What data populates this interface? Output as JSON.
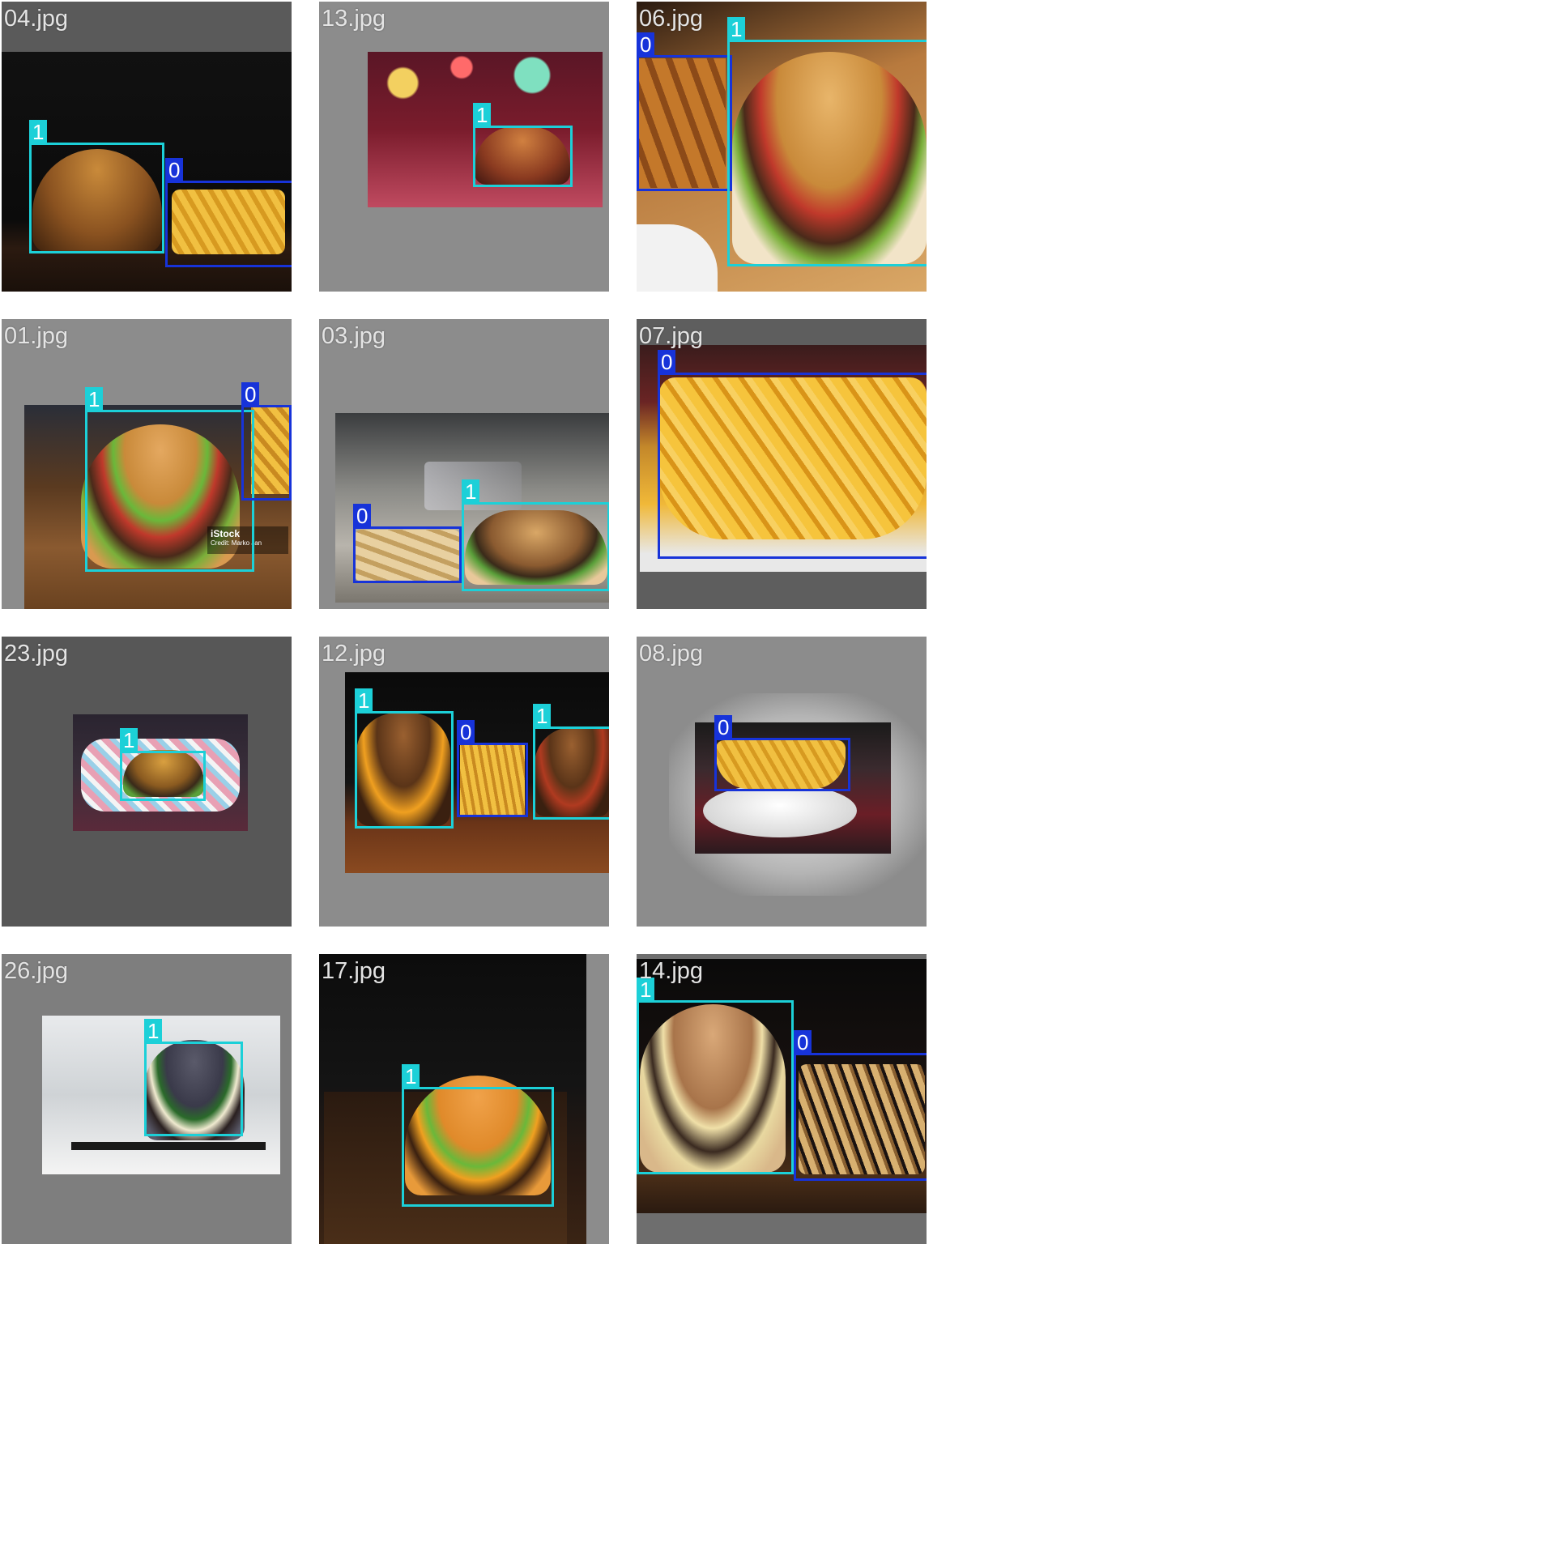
{
  "colors": {
    "class_0": "#1733d9",
    "class_1": "#1cd0d8",
    "label_text": "#e4e4e4",
    "page_bg": "#ffffff"
  },
  "tiles": [
    {
      "filename": "04.jpg",
      "boxes": [
        {
          "class_label": "1"
        },
        {
          "class_label": "0"
        }
      ]
    },
    {
      "filename": "13.jpg",
      "boxes": [
        {
          "class_label": "1"
        }
      ]
    },
    {
      "filename": "06.jpg",
      "boxes": [
        {
          "class_label": "0"
        },
        {
          "class_label": "1"
        }
      ]
    },
    {
      "filename": "01.jpg",
      "boxes": [
        {
          "class_label": "1"
        },
        {
          "class_label": "0"
        }
      ],
      "watermark_text": "iStock",
      "watermark_credit": "Credit: Marko Jan"
    },
    {
      "filename": "03.jpg",
      "boxes": [
        {
          "class_label": "0"
        },
        {
          "class_label": "1"
        }
      ]
    },
    {
      "filename": "07.jpg",
      "boxes": [
        {
          "class_label": "0"
        }
      ]
    },
    {
      "filename": "23.jpg",
      "boxes": [
        {
          "class_label": "1"
        }
      ]
    },
    {
      "filename": "12.jpg",
      "boxes": [
        {
          "class_label": "1"
        },
        {
          "class_label": "0"
        },
        {
          "class_label": "1"
        }
      ]
    },
    {
      "filename": "08.jpg",
      "boxes": [
        {
          "class_label": "0"
        }
      ]
    },
    {
      "filename": "26.jpg",
      "boxes": [
        {
          "class_label": "1"
        }
      ]
    },
    {
      "filename": "17.jpg",
      "boxes": [
        {
          "class_label": "1"
        }
      ]
    },
    {
      "filename": "14.jpg",
      "boxes": [
        {
          "class_label": "1"
        },
        {
          "class_label": "0"
        }
      ]
    }
  ]
}
